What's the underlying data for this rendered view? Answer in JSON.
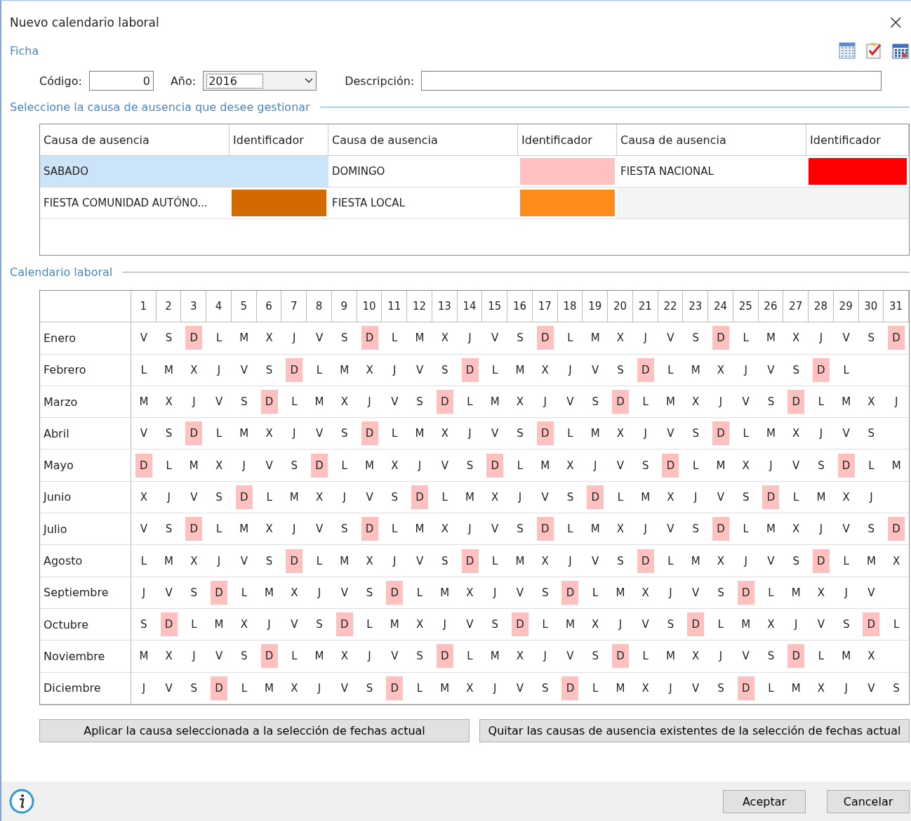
{
  "window": {
    "title": "Nuevo calendario laboral",
    "close": "×"
  },
  "ficha": {
    "title": "Ficha",
    "codigo_label": "Código:",
    "codigo_value": "0",
    "anio_label": "Año:",
    "anio_value": "2016",
    "descripcion_label": "Descripción:"
  },
  "causes": {
    "title": "Seleccione la causa de ausencia que desee gestionar",
    "columns": [
      "Causa de ausencia",
      "Identificador",
      "Causa de ausencia",
      "Identificador",
      "Causa de ausencia",
      "Identificador"
    ],
    "items": [
      {
        "name": "SABADO",
        "selected": true
      },
      {
        "name": "DOMINGO",
        "color": "#ffc0c0",
        "selected": false
      },
      {
        "name": "FIESTA NACIONAL",
        "color": "#ff0000",
        "selected": false
      },
      {
        "name": "FIESTA COMUNIDAD AUTÓNO...",
        "color": "#d26a00",
        "selected": false
      },
      {
        "name": "FIESTA LOCAL",
        "color": "#ff8c1a",
        "selected": false
      }
    ]
  },
  "calendar": {
    "title": "Calendario laboral",
    "day_numbers": [
      "1",
      "2",
      "3",
      "4",
      "5",
      "6",
      "7",
      "8",
      "9",
      "10",
      "11",
      "12",
      "13",
      "14",
      "15",
      "16",
      "17",
      "18",
      "19",
      "20",
      "21",
      "22",
      "23",
      "24",
      "25",
      "26",
      "27",
      "28",
      "29",
      "30",
      "31"
    ],
    "months": [
      {
        "name": "Enero",
        "days": [
          "V",
          "S",
          "D",
          "L",
          "M",
          "X",
          "J",
          "V",
          "S",
          "D",
          "L",
          "M",
          "X",
          "J",
          "V",
          "S",
          "D",
          "L",
          "M",
          "X",
          "J",
          "V",
          "S",
          "D",
          "L",
          "M",
          "X",
          "J",
          "V",
          "S",
          "D"
        ],
        "marked": [
          false,
          false,
          true,
          false,
          false,
          false,
          false,
          false,
          false,
          true,
          false,
          false,
          false,
          false,
          false,
          false,
          true,
          false,
          false,
          false,
          false,
          false,
          false,
          true,
          false,
          false,
          false,
          false,
          false,
          false,
          true
        ]
      },
      {
        "name": "Febrero",
        "days": [
          "L",
          "M",
          "X",
          "J",
          "V",
          "S",
          "D",
          "L",
          "M",
          "X",
          "J",
          "V",
          "S",
          "D",
          "L",
          "M",
          "X",
          "J",
          "V",
          "S",
          "D",
          "L",
          "M",
          "X",
          "J",
          "V",
          "S",
          "D",
          "L"
        ],
        "marked": [
          false,
          false,
          false,
          false,
          false,
          false,
          true,
          false,
          false,
          false,
          false,
          false,
          false,
          true,
          false,
          false,
          false,
          false,
          false,
          false,
          true,
          false,
          false,
          false,
          false,
          false,
          false,
          true,
          false
        ]
      },
      {
        "name": "Marzo",
        "days": [
          "M",
          "X",
          "J",
          "V",
          "S",
          "D",
          "L",
          "M",
          "X",
          "J",
          "V",
          "S",
          "D",
          "L",
          "M",
          "X",
          "J",
          "V",
          "S",
          "D",
          "L",
          "M",
          "X",
          "J",
          "V",
          "S",
          "D",
          "L",
          "M",
          "X",
          "J"
        ],
        "marked": [
          false,
          false,
          false,
          false,
          false,
          true,
          false,
          false,
          false,
          false,
          false,
          false,
          true,
          false,
          false,
          false,
          false,
          false,
          false,
          true,
          false,
          false,
          false,
          false,
          false,
          false,
          true,
          false,
          false,
          false,
          false
        ]
      },
      {
        "name": "Abril",
        "days": [
          "V",
          "S",
          "D",
          "L",
          "M",
          "X",
          "J",
          "V",
          "S",
          "D",
          "L",
          "M",
          "X",
          "J",
          "V",
          "S",
          "D",
          "L",
          "M",
          "X",
          "J",
          "V",
          "S",
          "D",
          "L",
          "M",
          "X",
          "J",
          "V",
          "S"
        ],
        "marked": [
          false,
          false,
          true,
          false,
          false,
          false,
          false,
          false,
          false,
          true,
          false,
          false,
          false,
          false,
          false,
          false,
          true,
          false,
          false,
          false,
          false,
          false,
          false,
          true,
          false,
          false,
          false,
          false,
          false,
          false
        ]
      },
      {
        "name": "Mayo",
        "days": [
          "D",
          "L",
          "M",
          "X",
          "J",
          "V",
          "S",
          "D",
          "L",
          "M",
          "X",
          "J",
          "V",
          "S",
          "D",
          "L",
          "M",
          "X",
          "J",
          "V",
          "S",
          "D",
          "L",
          "M",
          "X",
          "J",
          "V",
          "S",
          "D",
          "L",
          "M"
        ],
        "marked": [
          true,
          false,
          false,
          false,
          false,
          false,
          false,
          true,
          false,
          false,
          false,
          false,
          false,
          false,
          true,
          false,
          false,
          false,
          false,
          false,
          false,
          true,
          false,
          false,
          false,
          false,
          false,
          false,
          true,
          false,
          false
        ]
      },
      {
        "name": "Junio",
        "days": [
          "X",
          "J",
          "V",
          "S",
          "D",
          "L",
          "M",
          "X",
          "J",
          "V",
          "S",
          "D",
          "L",
          "M",
          "X",
          "J",
          "V",
          "S",
          "D",
          "L",
          "M",
          "X",
          "J",
          "V",
          "S",
          "D",
          "L",
          "M",
          "X",
          "J"
        ],
        "marked": [
          false,
          false,
          false,
          false,
          true,
          false,
          false,
          false,
          false,
          false,
          false,
          true,
          false,
          false,
          false,
          false,
          false,
          false,
          true,
          false,
          false,
          false,
          false,
          false,
          false,
          true,
          false,
          false,
          false,
          false
        ]
      },
      {
        "name": "Julio",
        "days": [
          "V",
          "S",
          "D",
          "L",
          "M",
          "X",
          "J",
          "V",
          "S",
          "D",
          "L",
          "M",
          "X",
          "J",
          "V",
          "S",
          "D",
          "L",
          "M",
          "X",
          "J",
          "V",
          "S",
          "D",
          "L",
          "M",
          "X",
          "J",
          "V",
          "S",
          "D"
        ],
        "marked": [
          false,
          false,
          true,
          false,
          false,
          false,
          false,
          false,
          false,
          true,
          false,
          false,
          false,
          false,
          false,
          false,
          true,
          false,
          false,
          false,
          false,
          false,
          false,
          true,
          false,
          false,
          false,
          false,
          false,
          false,
          true
        ]
      },
      {
        "name": "Agosto",
        "days": [
          "L",
          "M",
          "X",
          "J",
          "V",
          "S",
          "D",
          "L",
          "M",
          "X",
          "J",
          "V",
          "S",
          "D",
          "L",
          "M",
          "X",
          "J",
          "V",
          "S",
          "D",
          "L",
          "M",
          "X",
          "J",
          "V",
          "S",
          "D",
          "L",
          "M",
          "X"
        ],
        "marked": [
          false,
          false,
          false,
          false,
          false,
          false,
          true,
          false,
          false,
          false,
          false,
          false,
          false,
          true,
          false,
          false,
          false,
          false,
          false,
          false,
          true,
          false,
          false,
          false,
          false,
          false,
          false,
          true,
          false,
          false,
          false
        ]
      },
      {
        "name": "Septiembre",
        "days": [
          "J",
          "V",
          "S",
          "D",
          "L",
          "M",
          "X",
          "J",
          "V",
          "S",
          "D",
          "L",
          "M",
          "X",
          "J",
          "V",
          "S",
          "D",
          "L",
          "M",
          "X",
          "J",
          "V",
          "S",
          "D",
          "L",
          "M",
          "X",
          "J",
          "V"
        ],
        "marked": [
          false,
          false,
          false,
          true,
          false,
          false,
          false,
          false,
          false,
          false,
          true,
          false,
          false,
          false,
          false,
          false,
          false,
          true,
          false,
          false,
          false,
          false,
          false,
          false,
          true,
          false,
          false,
          false,
          false,
          false
        ]
      },
      {
        "name": "Octubre",
        "days": [
          "S",
          "D",
          "L",
          "M",
          "X",
          "J",
          "V",
          "S",
          "D",
          "L",
          "M",
          "X",
          "J",
          "V",
          "S",
          "D",
          "L",
          "M",
          "X",
          "J",
          "V",
          "S",
          "D",
          "L",
          "M",
          "X",
          "J",
          "V",
          "S",
          "D",
          "L"
        ],
        "marked": [
          false,
          true,
          false,
          false,
          false,
          false,
          false,
          false,
          true,
          false,
          false,
          false,
          false,
          false,
          false,
          true,
          false,
          false,
          false,
          false,
          false,
          false,
          true,
          false,
          false,
          false,
          false,
          false,
          false,
          true,
          false
        ]
      },
      {
        "name": "Noviembre",
        "days": [
          "M",
          "X",
          "J",
          "V",
          "S",
          "D",
          "L",
          "M",
          "X",
          "J",
          "V",
          "S",
          "D",
          "L",
          "M",
          "X",
          "J",
          "V",
          "S",
          "D",
          "L",
          "M",
          "X",
          "J",
          "V",
          "S",
          "D",
          "L",
          "M",
          "X"
        ],
        "marked": [
          false,
          false,
          false,
          false,
          false,
          true,
          false,
          false,
          false,
          false,
          false,
          false,
          true,
          false,
          false,
          false,
          false,
          false,
          false,
          true,
          false,
          false,
          false,
          false,
          false,
          false,
          true,
          false,
          false,
          false
        ]
      },
      {
        "name": "Diciembre",
        "days": [
          "J",
          "V",
          "S",
          "D",
          "L",
          "M",
          "X",
          "J",
          "V",
          "S",
          "D",
          "L",
          "M",
          "X",
          "J",
          "V",
          "S",
          "D",
          "L",
          "M",
          "X",
          "J",
          "V",
          "S",
          "D",
          "L",
          "M",
          "X",
          "J",
          "V",
          "S"
        ],
        "marked": [
          false,
          false,
          false,
          true,
          false,
          false,
          false,
          false,
          false,
          false,
          true,
          false,
          false,
          false,
          false,
          false,
          false,
          true,
          false,
          false,
          false,
          false,
          false,
          false,
          true,
          false,
          false,
          false,
          false,
          false,
          false
        ]
      }
    ]
  },
  "actions": [
    "Aplicar la causa seleccionada a la selección de fechas actual",
    "Quitar las causas de ausencia existentes de la selección de fechas actual"
  ],
  "footer": {
    "buttons": [
      "Aceptar",
      "Cancelar"
    ]
  }
}
